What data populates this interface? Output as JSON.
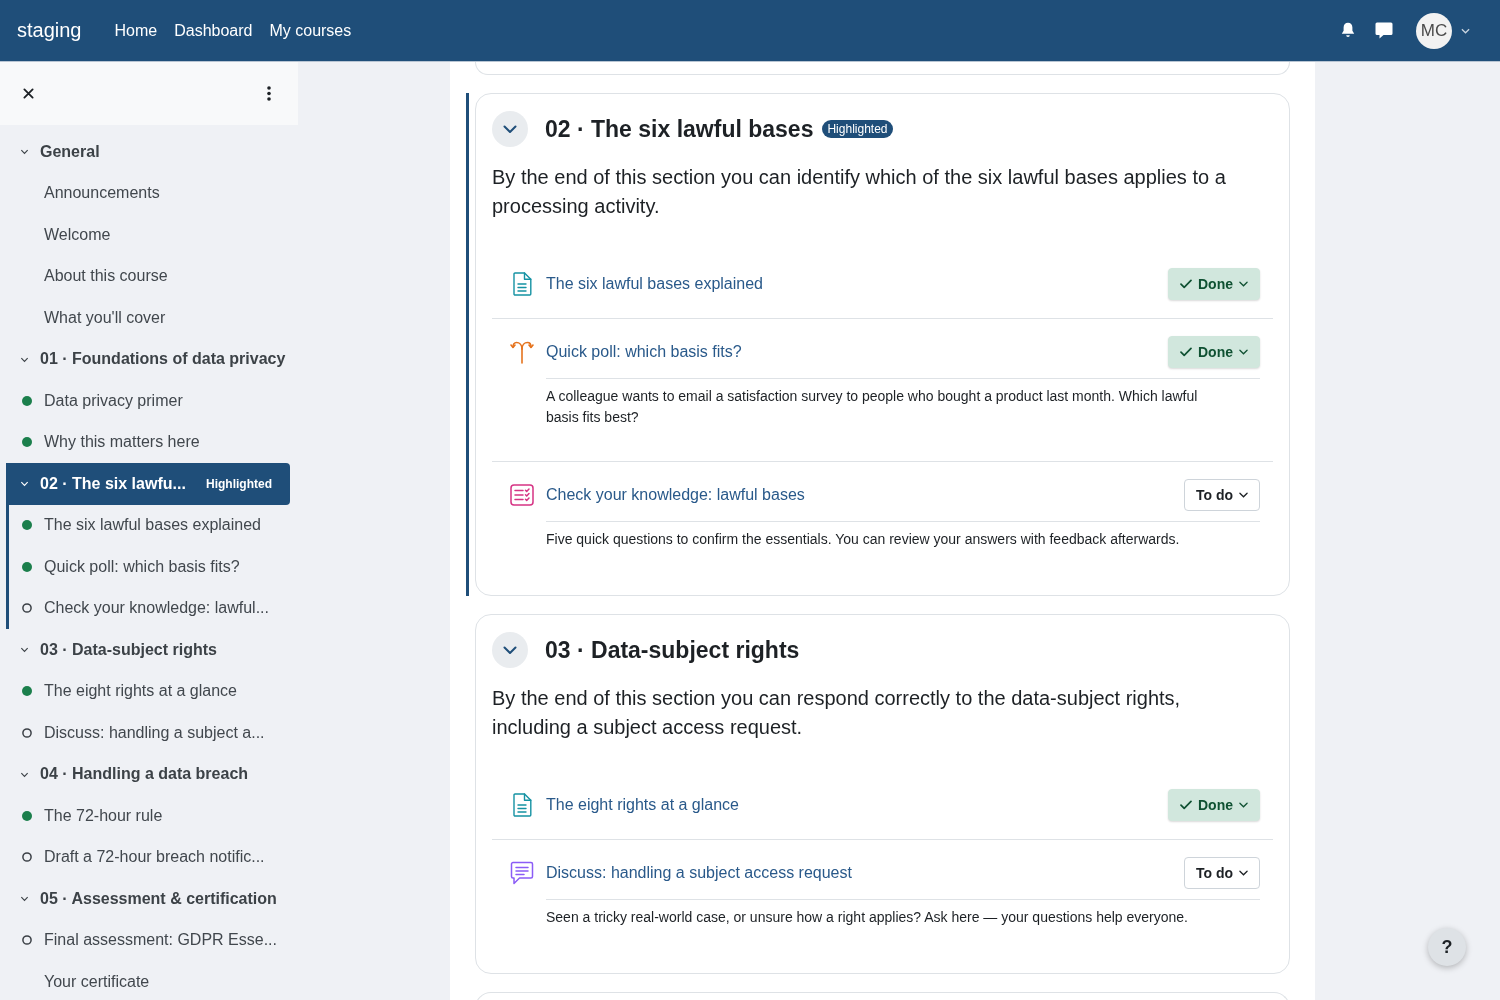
{
  "topbar": {
    "brand": "staging",
    "nav": [
      {
        "label": "Home"
      },
      {
        "label": "Dashboard"
      },
      {
        "label": "My courses"
      }
    ],
    "avatar": {
      "initials": "MC"
    }
  },
  "sidebar": {
    "sections": [
      {
        "title": "General",
        "expanded": true,
        "highlighted": false,
        "children": [
          {
            "label": "Announcements"
          },
          {
            "label": "Welcome"
          },
          {
            "label": "About this course"
          },
          {
            "label": "What you'll cover"
          }
        ]
      },
      {
        "title": "01 · Foundations of data privacy",
        "expanded": true,
        "highlighted": false,
        "children": [
          {
            "label": "Data privacy primer",
            "completed": true
          },
          {
            "label": "Why this matters here",
            "completed": true
          }
        ]
      },
      {
        "title": "02 · The six lawfu...",
        "badge": "Highlighted",
        "expanded": true,
        "highlighted": true,
        "children": [
          {
            "label": "The six lawful bases explained",
            "completed": true
          },
          {
            "label": "Quick poll: which basis fits?",
            "completed": true
          },
          {
            "label": "Check your knowledge: lawful...",
            "completed": false
          }
        ]
      },
      {
        "title": "03 · Data-subject rights",
        "expanded": true,
        "highlighted": false,
        "children": [
          {
            "label": "The eight rights at a glance",
            "completed": true
          },
          {
            "label": "Discuss: handling a subject a...",
            "completed": false
          }
        ]
      },
      {
        "title": "04 · Handling a data breach",
        "expanded": true,
        "highlighted": false,
        "children": [
          {
            "label": "The 72-hour rule",
            "completed": true
          },
          {
            "label": "Draft a 72-hour breach notific...",
            "completed": false
          }
        ]
      },
      {
        "title": "05 · Assessment & certification",
        "expanded": true,
        "highlighted": false,
        "children": [
          {
            "label": "Final assessment: GDPR Esse...",
            "completed": false
          },
          {
            "label": "Your certificate"
          }
        ]
      }
    ]
  },
  "main": {
    "sections": [
      {
        "title": "02 · The six lawful bases",
        "badge": "Highlighted",
        "highlighted": true,
        "expanded": true,
        "summary": "By the end of this section you can identify which of the six lawful bases applies to a processing activity.",
        "activities": [
          {
            "kind": "page",
            "title": "The six lawful bases explained",
            "status": "Done",
            "done": true
          },
          {
            "kind": "poll",
            "title": "Quick poll: which basis fits?",
            "status": "Done",
            "done": true,
            "description": "A colleague wants to email a satisfaction survey to people who bought a product last month. Which lawful basis fits best?"
          },
          {
            "kind": "quiz",
            "title": "Check your knowledge: lawful bases",
            "status": "To do",
            "done": false,
            "description": "Five quick questions to confirm the essentials. You can review your answers with feedback afterwards."
          }
        ]
      },
      {
        "title": "03 · Data-subject rights",
        "highlighted": false,
        "expanded": true,
        "summary": "By the end of this section you can respond correctly to the data-subject rights, including a subject access request.",
        "activities": [
          {
            "kind": "page",
            "title": "The eight rights at a glance",
            "status": "Done",
            "done": true
          },
          {
            "kind": "forum",
            "title": "Discuss: handling a subject access request",
            "status": "To do",
            "done": false,
            "description": "Seen a tricky real-world case, or unsure how a right applies? Ask here — your questions help everyone."
          }
        ]
      }
    ]
  },
  "help_button": {
    "label": "?"
  }
}
